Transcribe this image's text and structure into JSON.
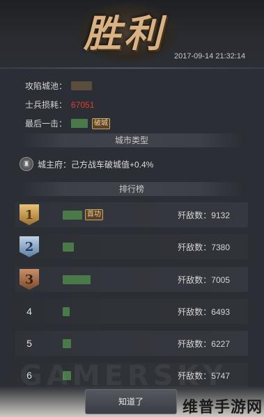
{
  "banner": {
    "title": "胜利",
    "timestamp": "2017-09-14 21:32:14"
  },
  "info": {
    "city_label": "攻陷城池：",
    "loss_label": "士兵损耗：",
    "loss_value": "67051",
    "last_hit_label": "最后一击：",
    "last_hit_tag": "破城"
  },
  "city_section": {
    "header": "城市类型",
    "city_text": "城主府：己方战车破城值+0.4%"
  },
  "ranking": {
    "header": "排行榜",
    "tag_first": "首功",
    "rows": [
      {
        "rank": "1",
        "kills": "歼敌数：9132"
      },
      {
        "rank": "2",
        "kills": "歼敌数：7380"
      },
      {
        "rank": "3",
        "kills": "歼敌数：7005"
      },
      {
        "rank": "4",
        "kills": "歼敌数：6493"
      },
      {
        "rank": "5",
        "kills": "歼敌数：6227"
      },
      {
        "rank": "6",
        "kills": "歼敌数：5747"
      }
    ]
  },
  "watermark": "GAMERSKY",
  "confirm_button": "知道了",
  "brand": "维普手游网",
  "colors": {
    "accent_red": "#e83b30",
    "gold": "#e8c27a"
  }
}
